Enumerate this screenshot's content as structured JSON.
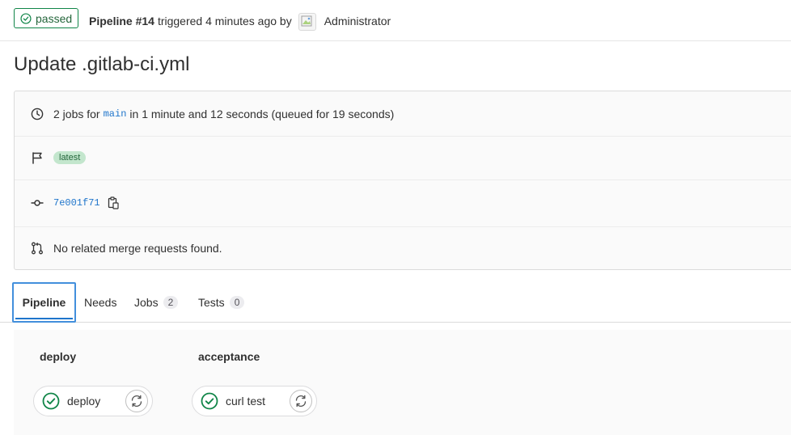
{
  "header": {
    "status": "passed",
    "pipeline_label": "Pipeline #14",
    "triggered_text": "triggered 4 minutes ago by",
    "user_name": "Administrator"
  },
  "title": "Update .gitlab-ci.yml",
  "info": {
    "jobs_prefix": "2 jobs for",
    "branch": "main",
    "jobs_suffix": "in 1 minute and 12 seconds (queued for 19 seconds)",
    "badge": "latest",
    "commit_sha": "7e001f71",
    "merge_requests": "No related merge requests found."
  },
  "tabs": [
    {
      "label": "Pipeline"
    },
    {
      "label": "Needs"
    },
    {
      "label": "Jobs",
      "count": "2"
    },
    {
      "label": "Tests",
      "count": "0"
    }
  ],
  "stages": [
    {
      "title": "deploy",
      "job": "deploy"
    },
    {
      "title": "acceptance",
      "job": "curl test"
    }
  ],
  "colors": {
    "success": "#108548",
    "link": "#1f75cb",
    "focus": "#428fdc"
  }
}
